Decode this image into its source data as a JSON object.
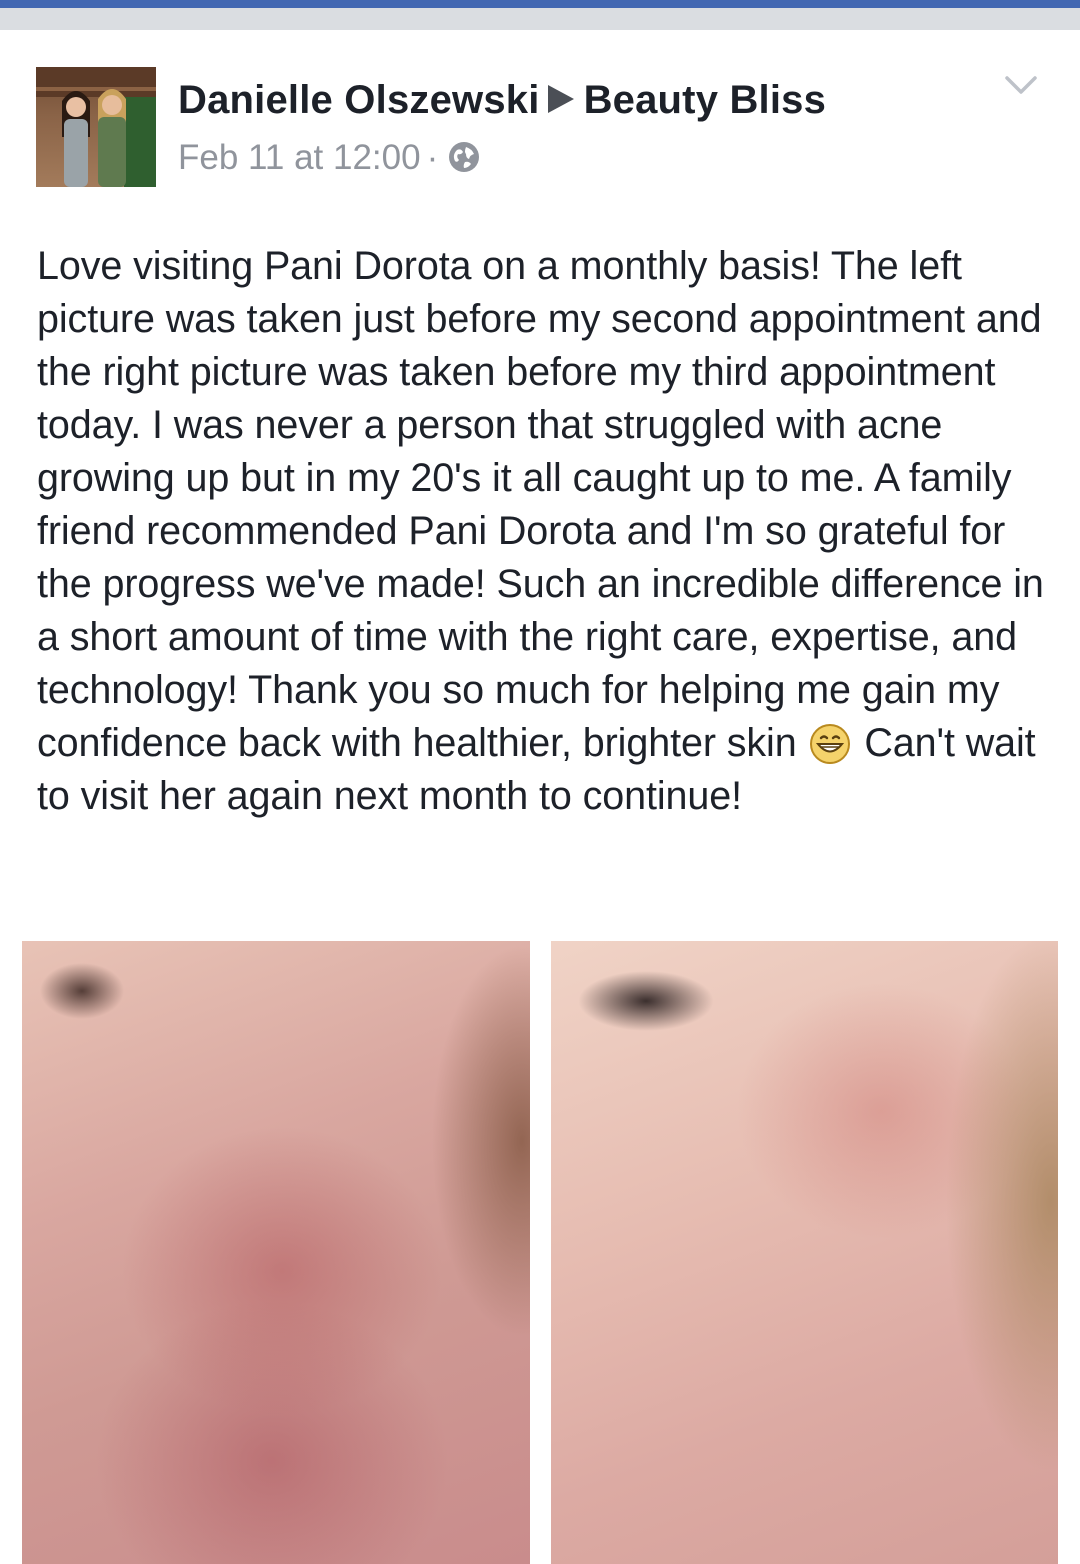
{
  "post": {
    "author": "Danielle Olszewski",
    "page": "Beauty Bliss",
    "date": "Feb 11 at 12:00",
    "separator": "·",
    "privacy_icon": "globe-icon",
    "menu_icon": "chevron-down-icon",
    "text_before_emoji": "Love visiting Pani Dorota on a monthly basis! The left picture was taken just before my second appointment and the right picture was taken before my third appointment today. I was never a person that struggled with acne growing up but in my 20's it all caught up to me. A family friend recommended Pani Dorota and I'm so grateful for the progress we've made! Such an incredible difference in a short amount of time with the right care, expertise, and technology! Thank you so much for helping me gain my confidence back with healthier, brighter skin",
    "emoji": "grinning-face-emoji",
    "text_after_emoji": "Can't wait to visit her again next month to continue!"
  },
  "colors": {
    "brand_blue": "#4267b2",
    "text": "#1d2129",
    "meta_gray": "#90949c"
  }
}
